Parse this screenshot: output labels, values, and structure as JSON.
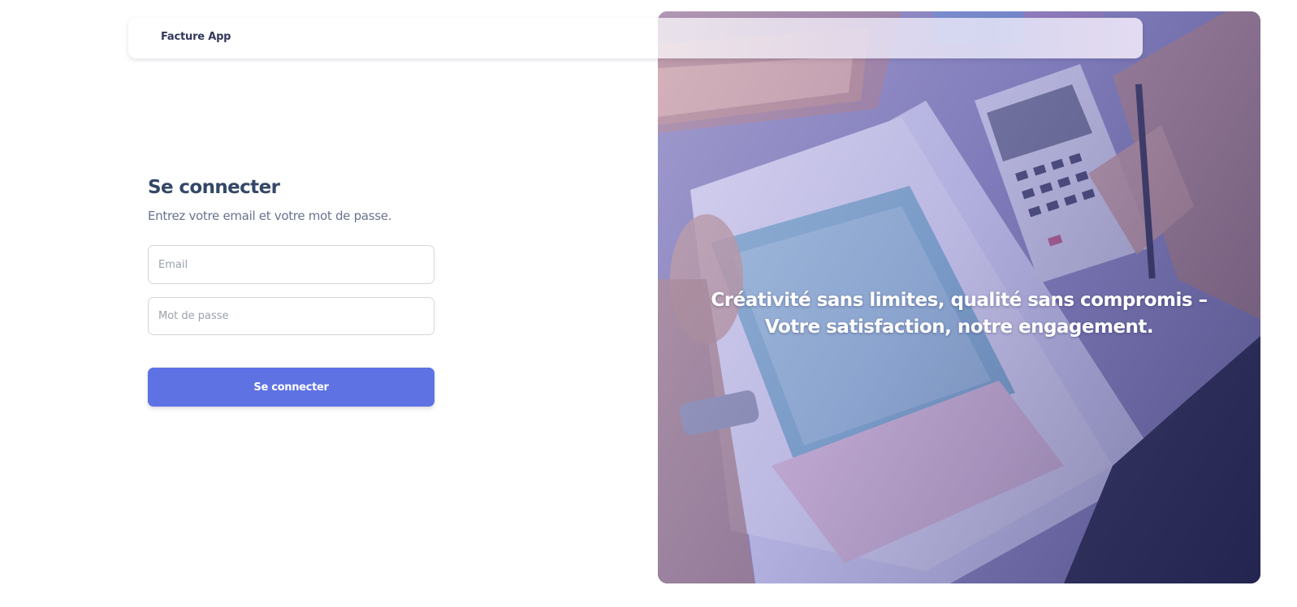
{
  "navbar": {
    "brand": "Facture App"
  },
  "login": {
    "title": "Se connecter",
    "subtitle": "Entrez votre email et votre mot de passe.",
    "email": {
      "value": "",
      "placeholder": "Email"
    },
    "password": {
      "value": "",
      "placeholder": "Mot de passe"
    },
    "submit_label": "Se connecter"
  },
  "hero": {
    "tagline_line1": "Créativité sans limites, qualité sans compromis –",
    "tagline_line2": "Votre satisfaction, notre engagement.",
    "image": "person-checking-invoices-with-calculator"
  },
  "colors": {
    "primary": "#5e72e4",
    "heading": "#344767",
    "text_muted": "#67748e",
    "hero_overlay": "#4b4a9c"
  }
}
